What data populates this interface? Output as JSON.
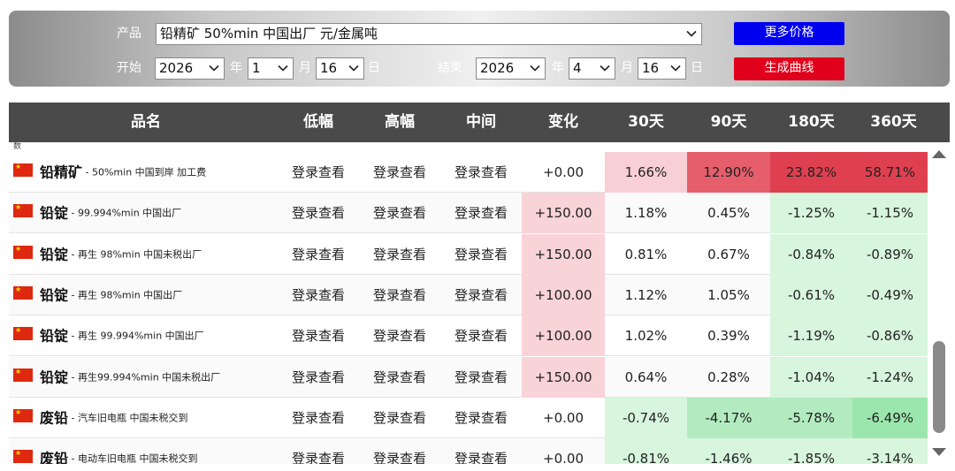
{
  "filters": {
    "product_label": "产品",
    "product_value": "铅精矿 50%min 中国出厂 元/金属吨",
    "start_label": "开始",
    "end_label": "结束",
    "start": {
      "year": "2026",
      "year_unit": "年",
      "month": "1",
      "month_unit": "月",
      "day": "16",
      "day_unit": "日"
    },
    "end": {
      "year": "2026",
      "year_unit": "年",
      "month": "4",
      "month_unit": "月",
      "day": "16",
      "day_unit": "日"
    },
    "more_prices_button": "更多价格",
    "generate_curve_button": "生成曲线",
    "colors": {
      "more_prices": "#0000ee",
      "generate_curve": "#e0001b"
    }
  },
  "table": {
    "stub_text": "数",
    "columns": [
      "品名",
      "低幅",
      "高幅",
      "中间",
      "变化",
      "30天",
      "90天",
      "180天",
      "360天"
    ],
    "rows": [
      {
        "name": "铅精矿",
        "desc": "50%min 中国到岸 加工费",
        "low": "登录查看",
        "high": "登录查看",
        "mid": "登录查看",
        "change": "+0.00",
        "d30": "1.66%",
        "d90": "12.90%",
        "d180": "23.82%",
        "d360": "58.71%"
      },
      {
        "name": "铅锭",
        "desc": "99.994%min 中国出厂",
        "low": "登录查看",
        "high": "登录查看",
        "mid": "登录查看",
        "change": "+150.00",
        "d30": "1.18%",
        "d90": "0.45%",
        "d180": "-1.25%",
        "d360": "-1.15%"
      },
      {
        "name": "铅锭",
        "desc": "再生 98%min 中国未税出厂",
        "low": "登录查看",
        "high": "登录查看",
        "mid": "登录查看",
        "change": "+150.00",
        "d30": "0.81%",
        "d90": "0.67%",
        "d180": "-0.84%",
        "d360": "-0.89%"
      },
      {
        "name": "铅锭",
        "desc": "再生 98%min 中国出厂",
        "low": "登录查看",
        "high": "登录查看",
        "mid": "登录查看",
        "change": "+100.00",
        "d30": "1.12%",
        "d90": "1.05%",
        "d180": "-0.61%",
        "d360": "-0.49%"
      },
      {
        "name": "铅锭",
        "desc": "再生 99.994%min 中国出厂",
        "low": "登录查看",
        "high": "登录查看",
        "mid": "登录查看",
        "change": "+100.00",
        "d30": "1.02%",
        "d90": "0.39%",
        "d180": "-1.19%",
        "d360": "-0.86%"
      },
      {
        "name": "铅锭",
        "desc": "再生99.994%min 中国未税出厂",
        "low": "登录查看",
        "high": "登录查看",
        "mid": "登录查看",
        "change": "+150.00",
        "d30": "0.64%",
        "d90": "0.28%",
        "d180": "-1.04%",
        "d360": "-1.24%"
      },
      {
        "name": "废铅",
        "desc": "汽车旧电瓶 中国未税交到",
        "low": "登录查看",
        "high": "登录查看",
        "mid": "登录查看",
        "change": "+0.00",
        "d30": "-0.74%",
        "d90": "-4.17%",
        "d180": "-5.78%",
        "d360": "-6.49%"
      },
      {
        "name": "废铅",
        "desc": "电动车旧电瓶 中国未税交到",
        "low": "登录查看",
        "high": "登录查看",
        "mid": "登录查看",
        "change": "+0.00",
        "d30": "-0.81%",
        "d90": "-1.46%",
        "d180": "-1.85%",
        "d360": "-3.14%"
      }
    ],
    "colors": {
      "change_up": "#f8d3d7",
      "pos_light": "#f8cfd4",
      "pos_mid": "#e65e6c",
      "pos_strong": "#df4050",
      "neg_light": "#d8f5de",
      "neg_mid": "#b3ebc0",
      "neg_strong": "#9be6ad"
    }
  }
}
